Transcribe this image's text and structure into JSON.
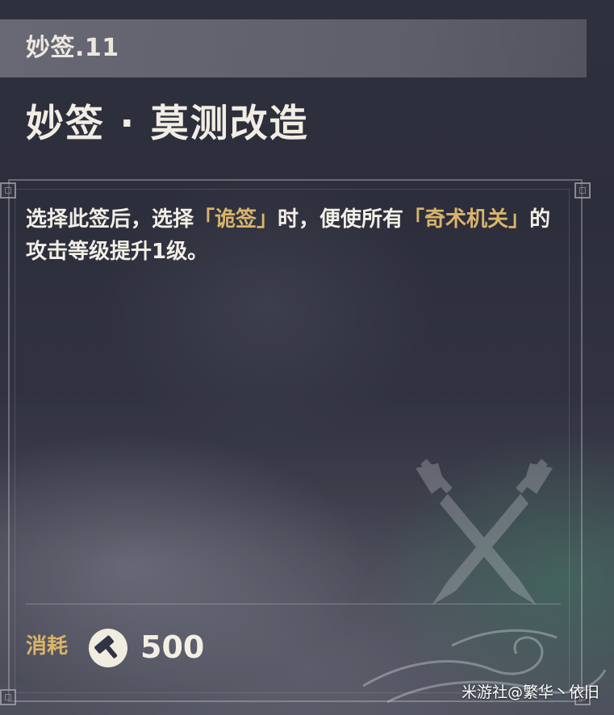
{
  "card": {
    "subtitle": "妙签.11",
    "title": "妙签 · 莫测改造",
    "description": {
      "part1": "选择此签后，选择",
      "highlight1": "「诡签」",
      "part2": "时，便使所有",
      "highlight2": "「奇术机关」",
      "part3": "的攻击等级提升1级。"
    },
    "cost": {
      "label": "消耗",
      "icon": "hammer-icon",
      "value": "500"
    },
    "emblem_icon": "crossed-swords-icon"
  },
  "watermark": "米游社@繁华丶依旧",
  "colors": {
    "highlight": "#d9b46a",
    "text": "#f2efe6",
    "background": "#2e2f3c"
  }
}
